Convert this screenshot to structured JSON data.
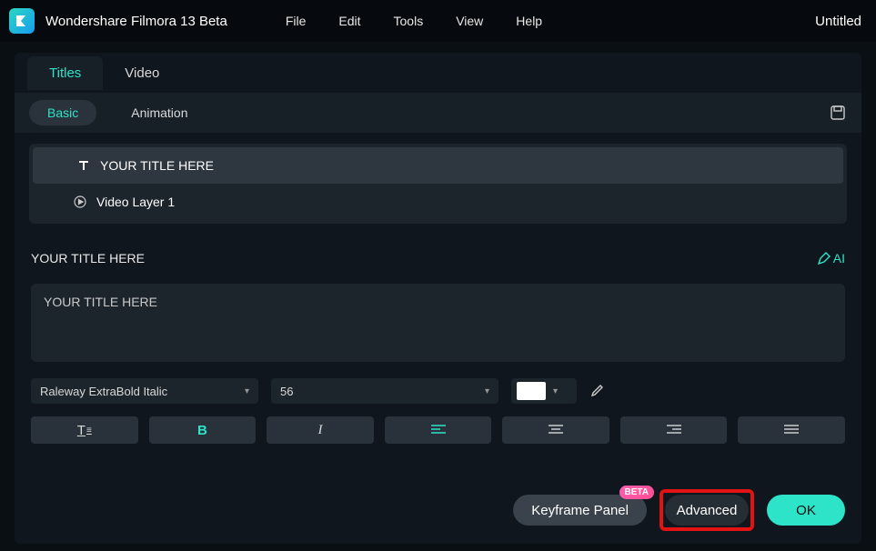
{
  "app": {
    "title": "Wondershare Filmora 13 Beta",
    "document": "Untitled"
  },
  "menu": [
    "File",
    "Edit",
    "Tools",
    "View",
    "Help"
  ],
  "tabs": {
    "titles": "Titles",
    "video": "Video"
  },
  "subtabs": {
    "basic": "Basic",
    "animation": "Animation"
  },
  "layers": {
    "title_layer": "YOUR TITLE HERE",
    "video_layer": "Video Layer 1"
  },
  "editor": {
    "header": "YOUR TITLE HERE",
    "ai_label": "AI",
    "text_value": "YOUR TITLE HERE",
    "font": "Raleway ExtraBold Italic",
    "size": "56",
    "color": "#ffffff"
  },
  "buttons": {
    "keyframe": "Keyframe Panel",
    "advanced": "Advanced",
    "ok": "OK",
    "beta": "BETA"
  }
}
